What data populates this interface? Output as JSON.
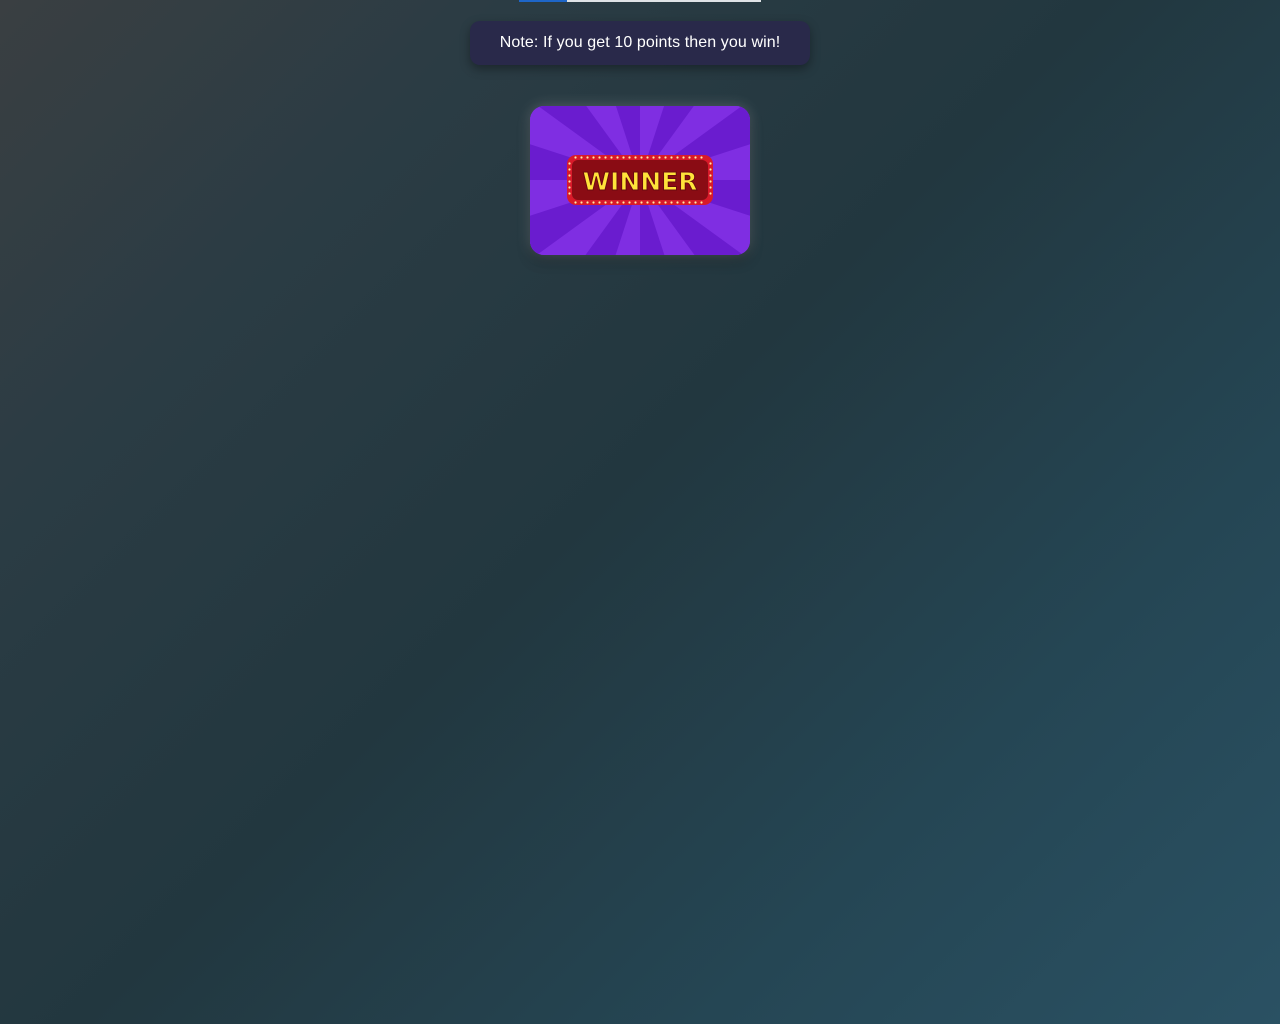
{
  "progress": {
    "fraction": 0.2,
    "fill_color": "#1e66c8"
  },
  "note": {
    "text": "Note: If you get 10 points then you win!"
  },
  "winner_card": {
    "label": "WINNER",
    "ray_color_light": "#7f2ee2",
    "ray_color_dark": "#6a1ccf",
    "sign_color": "#8a0c14",
    "text_color": "#ffe33a"
  }
}
